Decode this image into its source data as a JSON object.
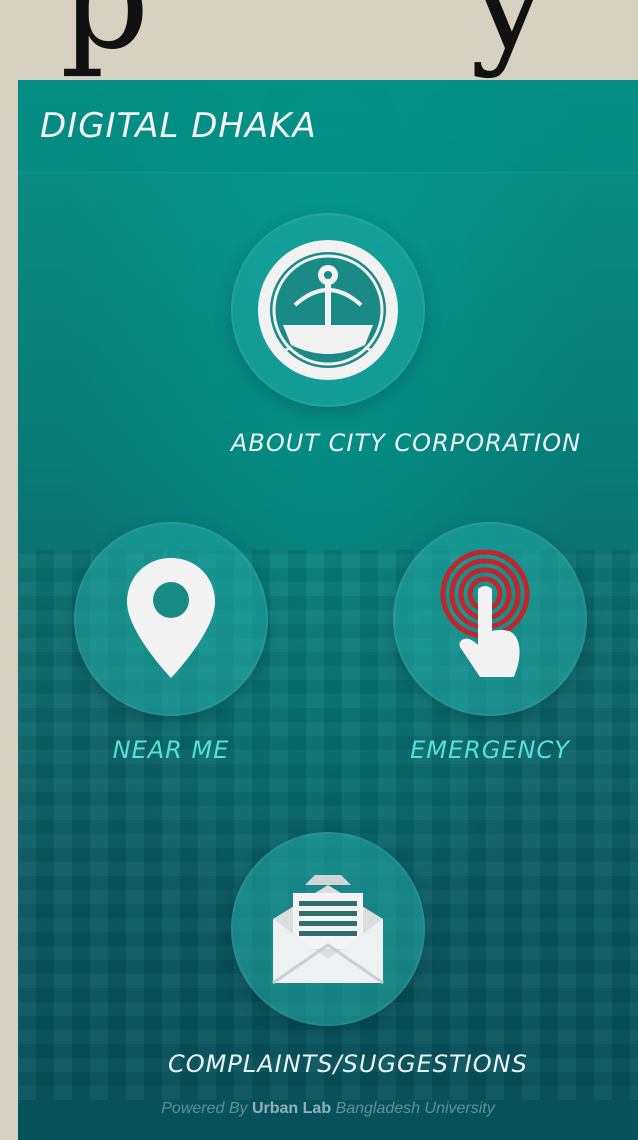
{
  "app": {
    "title": "DIGITAL DHAKA"
  },
  "tiles": {
    "about": {
      "label": "ABOUT CITY CORPORATION",
      "icon": "city-corporation-logo-icon"
    },
    "near_me": {
      "label": "NEAR ME",
      "icon": "location-pin-icon"
    },
    "emergency": {
      "label": "EMERGENCY",
      "icon": "emergency-touch-icon"
    },
    "complaints": {
      "label": "COMPLAINTS/SUGGESTIONS",
      "icon": "envelope-letter-icon"
    }
  },
  "footer": {
    "prefix": "Powered By",
    "brand": "Urban Lab",
    "suffix": "Bangladesh University"
  },
  "colors": {
    "background": "#d6d1c1",
    "teal_dark": "#07515a",
    "teal_light": "#0a8f86",
    "accent_label": "#55e0df",
    "emergency_red": "#c0262b"
  }
}
